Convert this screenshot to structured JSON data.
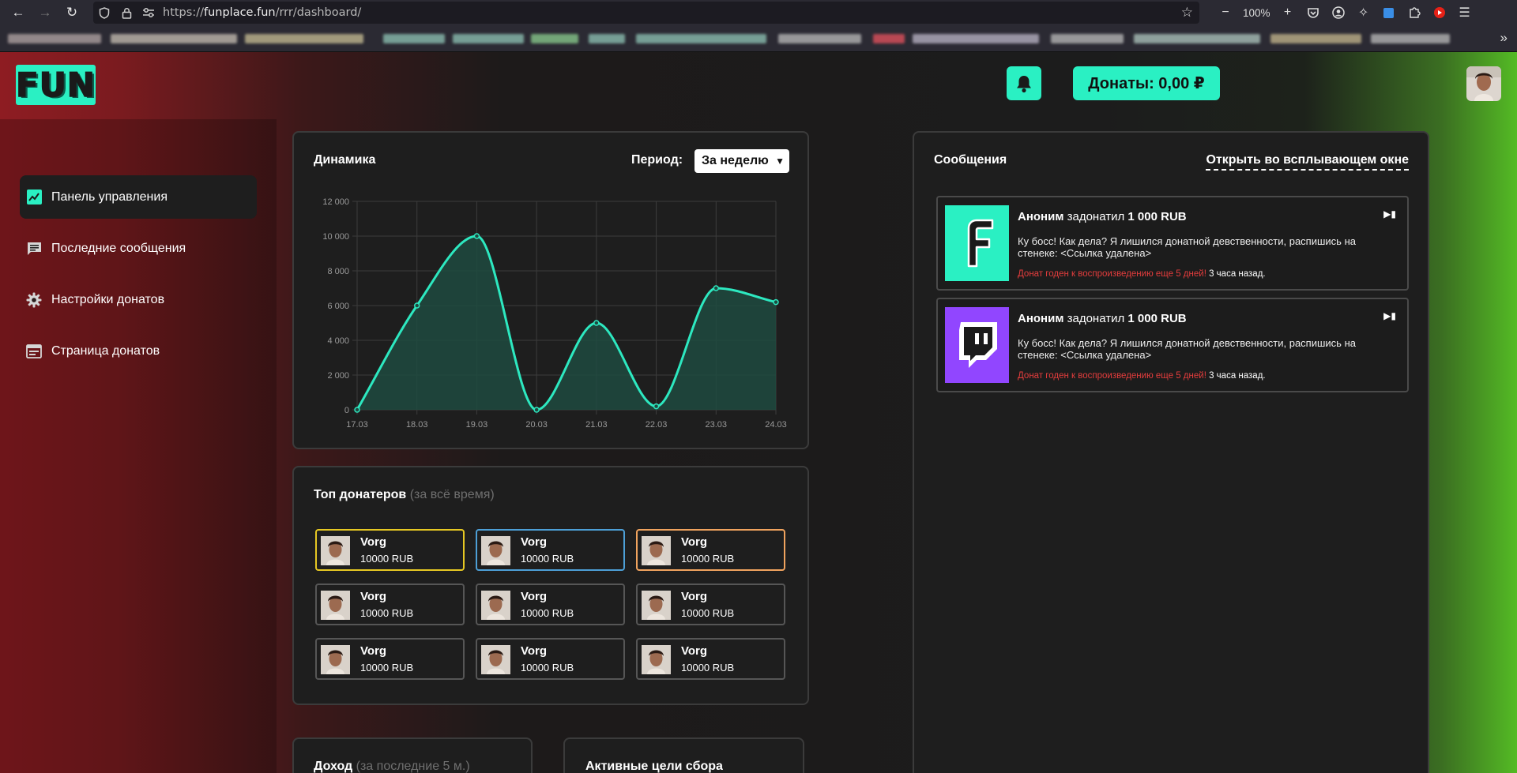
{
  "browser": {
    "url_prefix": "https://",
    "url_domain": "funplace.fun",
    "url_path": "/rrr/dashboard/",
    "zoom": "100%"
  },
  "header": {
    "logo_text": "FUN",
    "donate_button": "Донаты: 0,00 ₽"
  },
  "sidebar": {
    "items": [
      {
        "label": "Панель управления",
        "icon": "chart-line-icon",
        "active": true
      },
      {
        "label": "Последние сообщения",
        "icon": "message-icon",
        "active": false
      },
      {
        "label": "Настройки донатов",
        "icon": "gear-icon",
        "active": false
      },
      {
        "label": "Страница донатов",
        "icon": "page-icon",
        "active": false
      }
    ]
  },
  "dynamics": {
    "title": "Динамика",
    "period_label": "Период:",
    "period_value": "За неделю"
  },
  "chart_data": {
    "type": "area",
    "title": "Динамика",
    "x": [
      "17.03",
      "18.03",
      "19.03",
      "20.03",
      "21.03",
      "22.03",
      "23.03",
      "24.03"
    ],
    "series": [
      {
        "values": [
          0,
          6000,
          10000,
          0,
          5000,
          200,
          7000,
          6200
        ]
      }
    ],
    "y_ticks": [
      "0",
      "2 000",
      "4 000",
      "6 000",
      "8 000",
      "10 000",
      "12 000"
    ],
    "ylim": [
      0,
      12000
    ],
    "grid": true,
    "legend": "none",
    "colors": {
      "line": "#2de8c0",
      "fill": "#1e4a40"
    }
  },
  "top_donors": {
    "title": "Топ донатеров",
    "subtitle": "(за всё время)",
    "donors": [
      {
        "name": "Vorg",
        "amount": "10000 RUB",
        "border": "#e6c823"
      },
      {
        "name": "Vorg",
        "amount": "10000 RUB",
        "border": "#4d9fd6"
      },
      {
        "name": "Vorg",
        "amount": "10000 RUB",
        "border": "#f0a35e"
      },
      {
        "name": "Vorg",
        "amount": "10000 RUB",
        "border": "#565656"
      },
      {
        "name": "Vorg",
        "amount": "10000 RUB",
        "border": "#565656"
      },
      {
        "name": "Vorg",
        "amount": "10000 RUB",
        "border": "#565656"
      },
      {
        "name": "Vorg",
        "amount": "10000 RUB",
        "border": "#565656"
      },
      {
        "name": "Vorg",
        "amount": "10000 RUB",
        "border": "#565656"
      },
      {
        "name": "Vorg",
        "amount": "10000 RUB",
        "border": "#565656"
      }
    ]
  },
  "income": {
    "title": "Доход",
    "subtitle": "(за последние 5 м.)"
  },
  "goals": {
    "title": "Активные цели сбора"
  },
  "messages": {
    "title": "Сообщения",
    "popup_link": "Открыть во всплывающем окне",
    "items": [
      {
        "sender": "Аноним",
        "verb": "задонатил",
        "amount": "1 000 RUB",
        "text": "Ку босс! Как дела? Я лишился донатной девственности, распишись на стенеке: <Ссылка удалена>",
        "valid": "Донат годен к воспроизведению еще 5 дней!",
        "ago": "3 часа назад.",
        "source_icon": "funplace-f-icon",
        "bg": "#2af0c3"
      },
      {
        "sender": "Аноним",
        "verb": "задонатил",
        "amount": "1 000 RUB",
        "text": "Ку босс! Как дела? Я лишился донатной девственности, распишись на стенеке: <Ссылка удалена>",
        "valid": "Донат годен к воспроизведению еще 5 дней!",
        "ago": "3 часа назад.",
        "source_icon": "twitch-icon",
        "bg": "#9146ff"
      }
    ]
  },
  "colors": {
    "accent": "#2af0c3",
    "card_bg": "#1e1e1e",
    "warning_text": "#e53d3d"
  }
}
